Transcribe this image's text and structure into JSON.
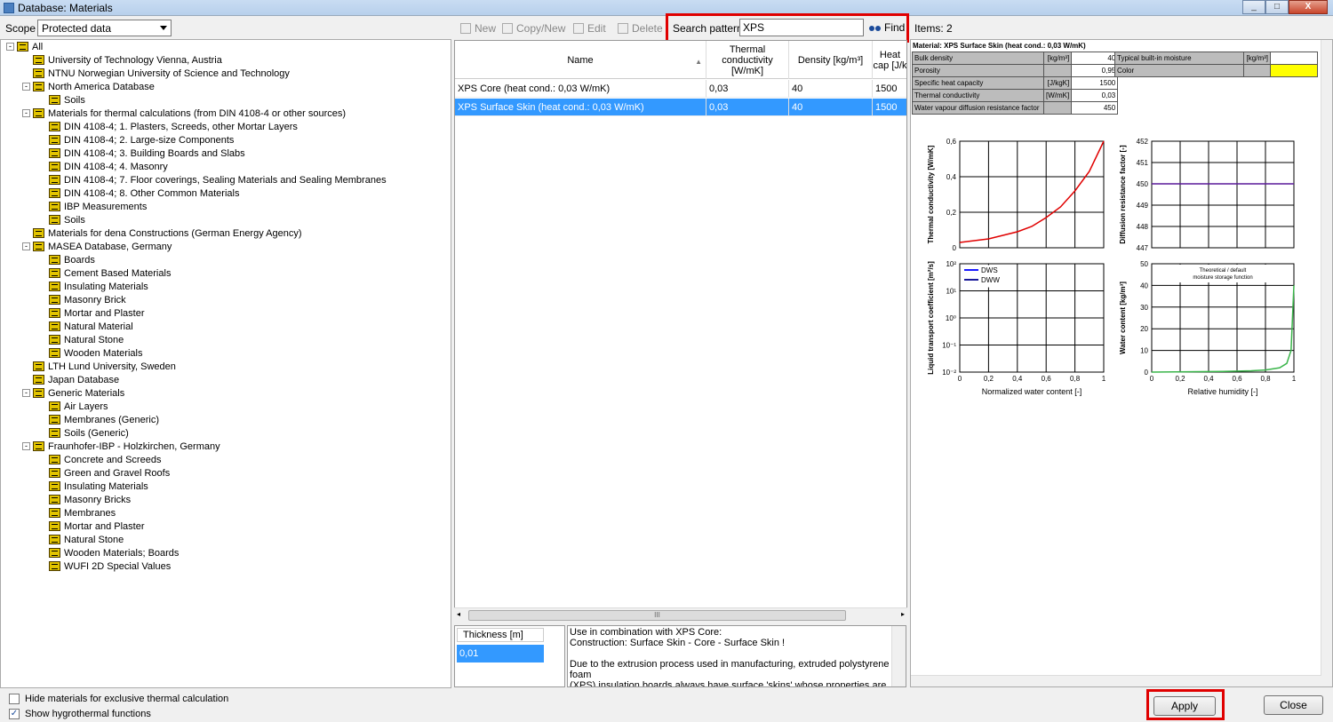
{
  "window": {
    "title": "Database: Materials",
    "controls": [
      "_",
      "□",
      "X"
    ]
  },
  "scope": {
    "label": "Scope",
    "value": "Protected data"
  },
  "tree": {
    "items": [
      {
        "label": "All",
        "level": 0,
        "expander": "-"
      },
      {
        "label": "University of Technology Vienna, Austria",
        "level": 1,
        "expander": ""
      },
      {
        "label": "NTNU Norwegian University of Science and Technology",
        "level": 1,
        "expander": ""
      },
      {
        "label": "North America Database",
        "level": 1,
        "expander": "-"
      },
      {
        "label": "Soils",
        "level": 2,
        "expander": ""
      },
      {
        "label": "Materials for thermal calculations (from DIN 4108-4 or other sources)",
        "level": 1,
        "expander": "-"
      },
      {
        "label": "DIN 4108-4; 1. Plasters, Screeds, other Mortar Layers",
        "level": 2,
        "expander": ""
      },
      {
        "label": "DIN 4108-4; 2. Large-size Components",
        "level": 2,
        "expander": ""
      },
      {
        "label": "DIN 4108-4; 3. Building Boards and Slabs",
        "level": 2,
        "expander": ""
      },
      {
        "label": "DIN 4108-4; 4. Masonry",
        "level": 2,
        "expander": ""
      },
      {
        "label": "DIN 4108-4; 7. Floor coverings, Sealing Materials and Sealing Membranes",
        "level": 2,
        "expander": ""
      },
      {
        "label": "DIN 4108-4; 8. Other Common Materials",
        "level": 2,
        "expander": ""
      },
      {
        "label": "IBP Measurements",
        "level": 2,
        "expander": ""
      },
      {
        "label": "Soils",
        "level": 2,
        "expander": ""
      },
      {
        "label": "Materials for dena Constructions (German Energy Agency)",
        "level": 1,
        "expander": ""
      },
      {
        "label": "MASEA Database, Germany",
        "level": 1,
        "expander": "-"
      },
      {
        "label": "Boards",
        "level": 2,
        "expander": ""
      },
      {
        "label": "Cement Based Materials",
        "level": 2,
        "expander": ""
      },
      {
        "label": "Insulating Materials",
        "level": 2,
        "expander": ""
      },
      {
        "label": "Masonry Brick",
        "level": 2,
        "expander": ""
      },
      {
        "label": "Mortar and Plaster",
        "level": 2,
        "expander": ""
      },
      {
        "label": "Natural Material",
        "level": 2,
        "expander": ""
      },
      {
        "label": "Natural Stone",
        "level": 2,
        "expander": ""
      },
      {
        "label": "Wooden Materials",
        "level": 2,
        "expander": ""
      },
      {
        "label": "LTH Lund University, Sweden",
        "level": 1,
        "expander": ""
      },
      {
        "label": "Japan Database",
        "level": 1,
        "expander": ""
      },
      {
        "label": "Generic Materials",
        "level": 1,
        "expander": "-"
      },
      {
        "label": "Air Layers",
        "level": 2,
        "expander": ""
      },
      {
        "label": "Membranes (Generic)",
        "level": 2,
        "expander": ""
      },
      {
        "label": "Soils (Generic)",
        "level": 2,
        "expander": ""
      },
      {
        "label": "Fraunhofer-IBP - Holzkirchen, Germany",
        "level": 1,
        "expander": "-"
      },
      {
        "label": "Concrete and Screeds",
        "level": 2,
        "expander": ""
      },
      {
        "label": "Green and Gravel Roofs",
        "level": 2,
        "expander": ""
      },
      {
        "label": "Insulating Materials",
        "level": 2,
        "expander": ""
      },
      {
        "label": "Masonry Bricks",
        "level": 2,
        "expander": ""
      },
      {
        "label": "Membranes",
        "level": 2,
        "expander": ""
      },
      {
        "label": "Mortar and Plaster",
        "level": 2,
        "expander": ""
      },
      {
        "label": "Natural Stone",
        "level": 2,
        "expander": ""
      },
      {
        "label": "Wooden Materials; Boards",
        "level": 2,
        "expander": ""
      },
      {
        "label": "WUFI 2D Special Values",
        "level": 2,
        "expander": ""
      }
    ]
  },
  "options": {
    "hide_exclusive": {
      "label": "Hide materials for exclusive thermal calculation",
      "checked": false
    },
    "show_hygro": {
      "label": "Show hygrothermal functions",
      "checked": true
    }
  },
  "toolbar": {
    "new": "New",
    "copy_new": "Copy/New",
    "edit": "Edit",
    "delete": "Delete"
  },
  "search": {
    "label": "Search pattern",
    "value": "XPS",
    "find": "Find"
  },
  "items_count": "Items: 2",
  "grid": {
    "columns": [
      "Name",
      "Thermal conductivity [W/mK]",
      "Density [kg/m³]",
      "Heat cap [J/k"
    ],
    "rows": [
      {
        "name": "XPS Core (heat cond.: 0,03 W/mK)",
        "conductivity": "0,03",
        "density": "40",
        "heat_cap": "1500",
        "selected": false
      },
      {
        "name": "XPS Surface Skin (heat cond.: 0,03 W/mK)",
        "conductivity": "0,03",
        "density": "40",
        "heat_cap": "1500",
        "selected": true
      }
    ],
    "hscroll_grip": "III"
  },
  "thickness": {
    "header": "Thickness [m]",
    "value": "0,01"
  },
  "notes": [
    "Use in combination with XPS Core:",
    "Construction: Surface Skin - Core - Surface Skin !",
    "",
    "Due to the extrusion process used in manufacturing, extruded polystyrene foam",
    "(XPS) insulation boards always have surface 'skins' whose properties are slightly"
  ],
  "material": {
    "title": "Material: XPS Surface Skin (heat cond.: 0,03 W/mK)",
    "props": [
      {
        "name": "Bulk density",
        "unit": "[kg/m³]",
        "value": "40"
      },
      {
        "name": "Porosity",
        "unit": "",
        "value": "0,95"
      },
      {
        "name": "Specific heat capacity",
        "unit": "[J/kgK]",
        "value": "1500"
      },
      {
        "name": "Thermal conductivity",
        "unit": "[W/mK]",
        "value": "0,03"
      },
      {
        "name": "Water vapour diffusion resistance factor",
        "unit": "",
        "value": "450"
      }
    ],
    "props2": [
      {
        "name": "Typical built-in moisture",
        "unit": "[kg/m³]",
        "value": ""
      },
      {
        "name": "Color",
        "unit": "",
        "value": ""
      }
    ],
    "color_swatch": "#ffff00"
  },
  "chart_data": [
    {
      "type": "line",
      "ylabel": "Thermal conductivity [W/mK]",
      "xlabel": "",
      "xlim": [
        0,
        1
      ],
      "ylim": [
        0,
        0.6
      ],
      "yticks": [
        "0,6",
        "0,4",
        "0,2",
        "0"
      ],
      "series": [
        {
          "color": "#e00000",
          "x": [
            0,
            0.1,
            0.2,
            0.3,
            0.4,
            0.5,
            0.6,
            0.7,
            0.8,
            0.9,
            1.0
          ],
          "y": [
            0.03,
            0.04,
            0.05,
            0.07,
            0.09,
            0.12,
            0.17,
            0.23,
            0.32,
            0.43,
            0.6
          ]
        }
      ]
    },
    {
      "type": "line",
      "ylabel": "Diffusion resistance factor [-]",
      "xlabel": "",
      "xlim": [
        0,
        1
      ],
      "ylim": [
        447,
        452
      ],
      "yticks": [
        "452",
        "451",
        "450",
        "449",
        "448",
        "447"
      ],
      "series": [
        {
          "color": "#5a1a9a",
          "x": [
            0,
            1
          ],
          "y": [
            450,
            450
          ]
        }
      ]
    },
    {
      "type": "line",
      "ylabel": "Liquid transport coefficient [m²/s]",
      "xlabel": "Normalized water content [-]",
      "xlim": [
        0,
        1
      ],
      "ylim": [
        -12,
        2
      ],
      "yticks": [
        "10²",
        "10¹",
        "10⁰",
        "10⁻¹",
        "10⁻²"
      ],
      "xticks": [
        "0",
        "0,2",
        "0,4",
        "0,6",
        "0,8",
        "1"
      ],
      "legend": [
        "DWS",
        "DWW"
      ],
      "legend_colors": [
        "#1a1aff",
        "#1a1a9a"
      ],
      "series": []
    },
    {
      "type": "line",
      "ylabel": "Water content [kg/m³]",
      "xlabel": "Relative humidity [-]",
      "title": "Theoretical / default moisture storage function",
      "xlim": [
        0,
        1
      ],
      "ylim": [
        0,
        50
      ],
      "yticks": [
        "50",
        "40",
        "30",
        "20",
        "10",
        "0"
      ],
      "xticks": [
        "0",
        "0,2",
        "0,4",
        "0,6",
        "0,8",
        "1"
      ],
      "series": [
        {
          "color": "#3ab54a",
          "x": [
            0,
            0.5,
            0.7,
            0.8,
            0.9,
            0.95,
            0.98,
            1.0
          ],
          "y": [
            0,
            0.3,
            0.6,
            1.0,
            2.0,
            4.0,
            10,
            40
          ]
        }
      ]
    }
  ],
  "chart_titles": {
    "moisture_line1": "Theoretical / default",
    "moisture_line2": "moisture storage function"
  },
  "buttons": {
    "apply": "Apply",
    "close": "Close"
  }
}
